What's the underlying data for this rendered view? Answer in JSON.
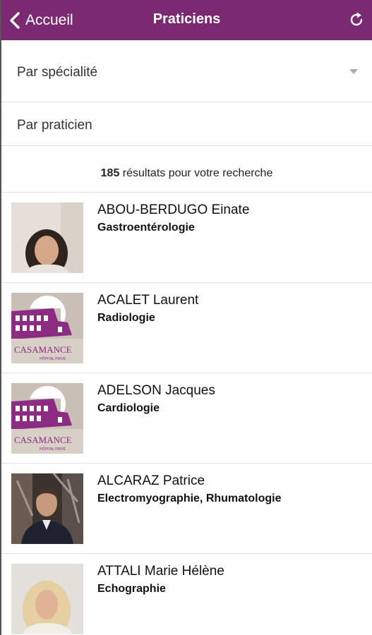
{
  "nav": {
    "back_label": "Accueil",
    "title": "Praticiens",
    "back_icon": "chevron-left-icon",
    "refresh_icon": "refresh-icon"
  },
  "filters": {
    "specialty_label": "Par spécialité",
    "practitioner_label": "Par praticien"
  },
  "results": {
    "count": "185",
    "text": " résultats pour votre recherche"
  },
  "colors": {
    "brand": "#7b2a72"
  },
  "practitioners": [
    {
      "name": "ABOU-BERDUGO Einate",
      "specialty": "Gastroentérologie",
      "photo": "portrait-woman-dark-hair"
    },
    {
      "name": "ACALET Laurent",
      "specialty": "Radiologie",
      "photo": "casamance-logo"
    },
    {
      "name": "ADELSON Jacques",
      "specialty": "Cardiologie",
      "photo": "casamance-logo"
    },
    {
      "name": "ALCARAZ Patrice",
      "specialty": "Electromyographie, Rhumatologie",
      "photo": "portrait-man-suit"
    },
    {
      "name": "ATTALI Marie Hélène",
      "specialty": "Echographie",
      "photo": "portrait-woman-blonde"
    }
  ],
  "logo_text": {
    "brand": "CASAMANCE",
    "sub": "HÔPITAL PRIVÉ"
  }
}
